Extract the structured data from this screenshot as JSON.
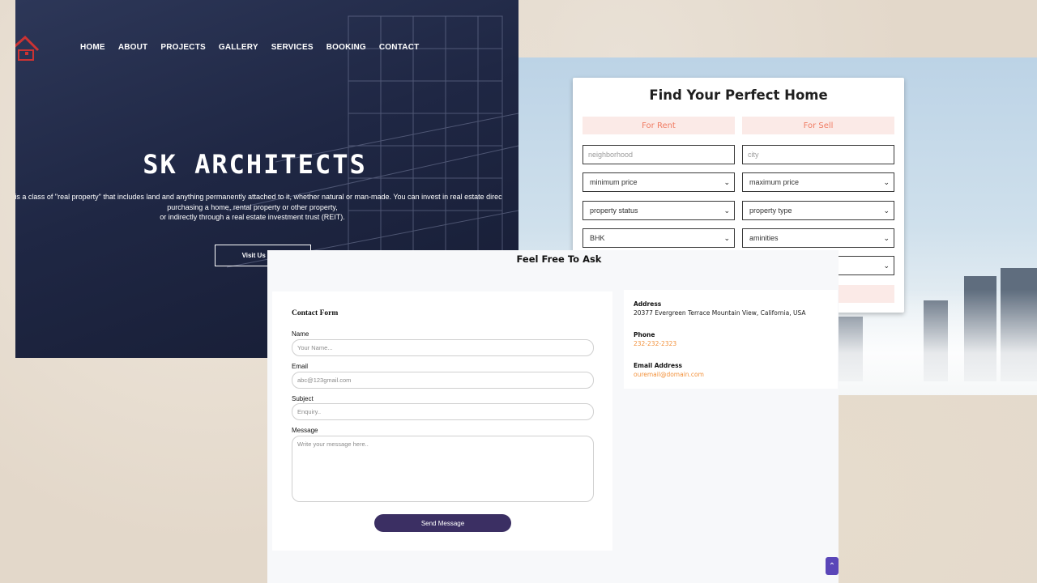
{
  "hero": {
    "nav": [
      "HOME",
      "ABOUT",
      "PROJECTS",
      "GALLERY",
      "SERVICES",
      "BOOKING",
      "CONTACT"
    ],
    "title": "SK ARCHITECTS",
    "text_lines": [
      "ate is a class of \"real property\" that includes land and anything permanently attached to it, whether natural or man-made. You can invest in real estate direc",
      "purchasing a home, rental property or other property,",
      "or indirectly through a real estate investment trust (REIT)."
    ],
    "button": "Visit Us to Kn"
  },
  "search": {
    "title": "Find Your Perfect Home",
    "tabs": [
      "For Rent",
      "For Sell"
    ],
    "neighborhood_placeholder": "neighborhood",
    "city_placeholder": "city",
    "min_price": "minimum price",
    "max_price": "maximum price",
    "property_status": "property status",
    "property_type": "property type",
    "bhk": "BHK",
    "aminities": "aminities"
  },
  "contact": {
    "heading": "Feel Free To Ask",
    "form_title": "Contact Form",
    "name_label": "Name",
    "name_placeholder": "Your Name...",
    "email_label": "Email",
    "email_placeholder": "abc@123gmail.com",
    "subject_label": "Subject",
    "subject_placeholder": "Enquiry..",
    "message_label": "Message",
    "message_placeholder": "Write your message here..",
    "send_label": "Send Message",
    "address_label": "Address",
    "address": "20377 Evergreen Terrace Mountain View, California, USA",
    "phone_label": "Phone",
    "phone": "232-232-2323",
    "email_address_label": "Email Address",
    "email_address": "ouremail@domain.com"
  },
  "colors": {
    "accent_orange": "#f2913b",
    "button_purple": "#3b2f63",
    "tab_pink": "#fbeae7",
    "hero_navy": "#1f2744"
  },
  "icons": {
    "logo": "house-logo-icon",
    "scroll_top": "chevron-up-icon",
    "select": "chevron-down-icon"
  }
}
